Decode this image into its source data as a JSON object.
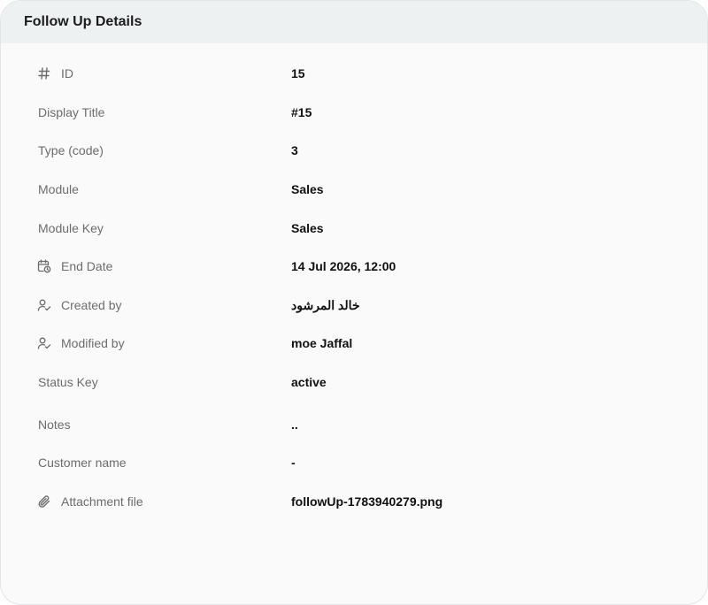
{
  "panel": {
    "title": "Follow Up Details"
  },
  "fields": [
    {
      "label": "ID",
      "value": "15",
      "icon": "hash-icon"
    },
    {
      "label": "Display Title",
      "value": "#15",
      "icon": ""
    },
    {
      "label": "Type (code)",
      "value": "3",
      "icon": ""
    },
    {
      "label": "Module",
      "value": "Sales",
      "icon": ""
    },
    {
      "label": "Module Key",
      "value": "Sales",
      "icon": ""
    },
    {
      "label": "End Date",
      "value": "14 Jul 2026, 12:00",
      "icon": "calendar-clock-icon"
    },
    {
      "label": "Created by",
      "value": "خالد المرشود",
      "icon": "user-check-icon"
    },
    {
      "label": "Modified by",
      "value": "moe Jaffal",
      "icon": "user-check-icon"
    },
    {
      "label": "Status Key",
      "value": "active",
      "icon": ""
    },
    {
      "label": "Notes",
      "value": "..",
      "icon": ""
    },
    {
      "label": "Customer name",
      "value": "-",
      "icon": ""
    },
    {
      "label": "Attachment file",
      "value": "followUp-1783940279.png",
      "icon": "paperclip-icon"
    }
  ]
}
